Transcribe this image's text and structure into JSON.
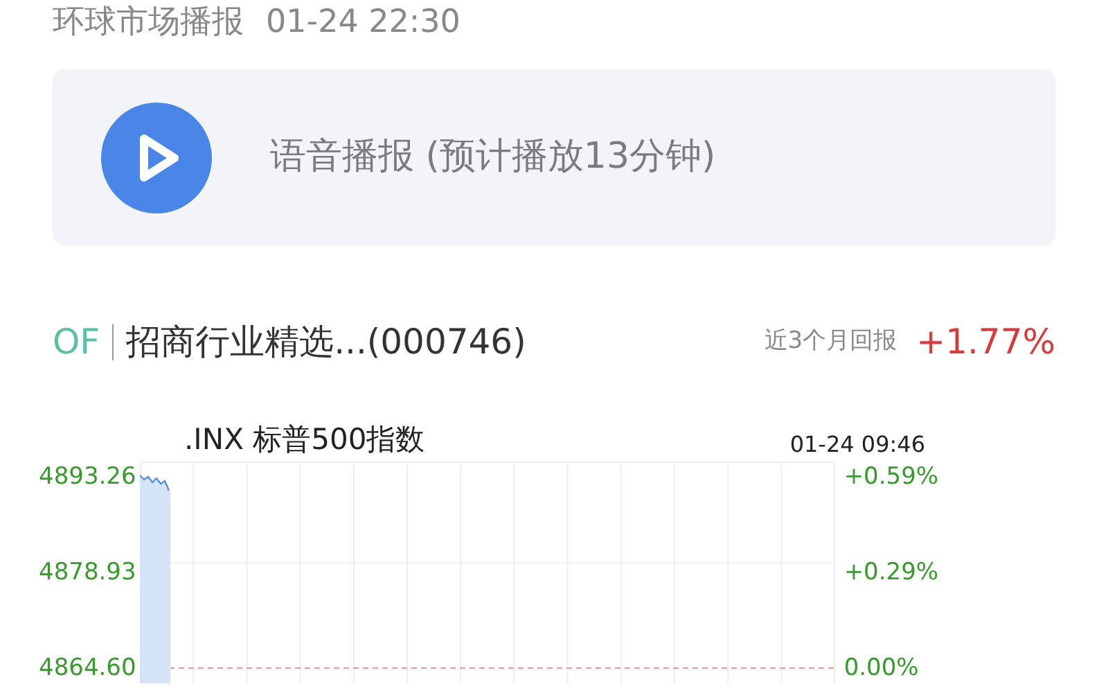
{
  "header": {
    "title": "环球市场播报",
    "time": "01-24 22:30"
  },
  "audio": {
    "label": "语音播报 (预计播放13分钟)"
  },
  "fund": {
    "tag": "OF",
    "name": "招商行业精选...(000746)",
    "return_label": "近3个月回报",
    "return_value": "+1.77%"
  },
  "chart": {
    "title": ".INX 标普500指数",
    "time": "01-24 09:46",
    "left_ticks": [
      "4893.26",
      "4878.93",
      "4864.60"
    ],
    "right_ticks": [
      "+0.59%",
      "+0.29%",
      "0.00%"
    ]
  }
}
